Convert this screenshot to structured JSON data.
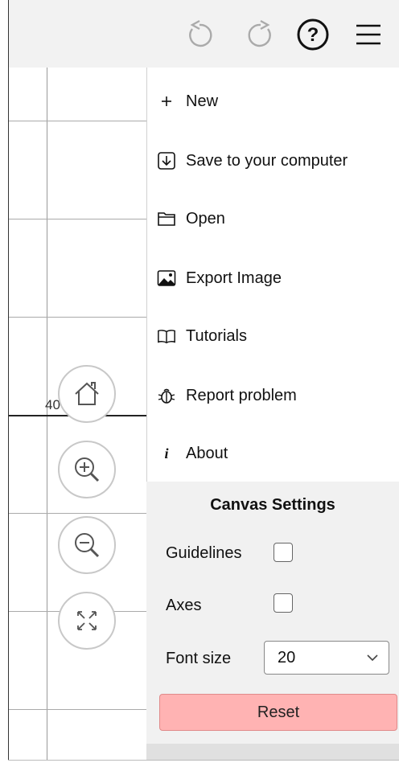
{
  "toolbar": {
    "undo_icon": "undo-icon",
    "redo_icon": "redo-icon",
    "help_icon": "help-icon",
    "menu_icon": "hamburger-menu-icon"
  },
  "canvas": {
    "tick_label": "40"
  },
  "zoom_controls": [
    "home-icon",
    "zoom-in-icon",
    "zoom-out-icon",
    "fullscreen-icon"
  ],
  "menu": {
    "items": [
      {
        "label": "New",
        "icon": "plus-icon"
      },
      {
        "label": "Save to your computer",
        "icon": "download-icon"
      },
      {
        "label": "Open",
        "icon": "folder-icon"
      },
      {
        "label": "Export Image",
        "icon": "image-icon"
      },
      {
        "label": "Tutorials",
        "icon": "book-icon"
      },
      {
        "label": "Report problem",
        "icon": "bug-icon"
      },
      {
        "label": "About",
        "icon": "info-icon"
      }
    ]
  },
  "settings": {
    "title": "Canvas Settings",
    "guidelines_label": "Guidelines",
    "guidelines_checked": false,
    "axes_label": "Axes",
    "axes_checked": false,
    "font_size_label": "Font size",
    "font_size_value": "20",
    "reset_label": "Reset"
  },
  "colors": {
    "toolbar_bg": "#f2f2f2",
    "settings_bg": "#f1f1f1",
    "reset_bg": "#ffb3b3"
  }
}
